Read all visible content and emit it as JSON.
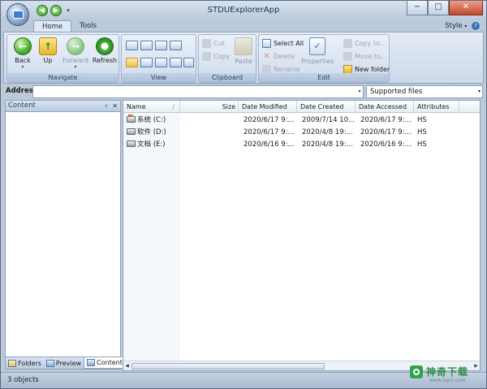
{
  "window": {
    "title": "STDUExplorerApp"
  },
  "caption": {
    "minimize": "−",
    "maximize": "□",
    "close": "✕"
  },
  "quick_access": {
    "arrows": [
      "◀",
      "▶"
    ],
    "drop": "▾"
  },
  "ribbon": {
    "tabs": [
      "Home",
      "Tools"
    ],
    "active_tab": "Home",
    "style_menu": "Style",
    "help": "?",
    "groups": {
      "navigate": {
        "label": "Navigate",
        "back": "Back",
        "up": "Up",
        "forward": "Forward",
        "refresh": "Refresh"
      },
      "view": {
        "label": "View"
      },
      "clipboard": {
        "label": "Clipboard",
        "cut": "Cut",
        "copy": "Copy",
        "paste": "Paste"
      },
      "edit": {
        "label": "Edit",
        "select_all": "Select All",
        "delete": "Delete",
        "rename": "Rename",
        "properties": "Properties",
        "copy_to": "Copy to...",
        "move_to": "Move to...",
        "new_folder": "New folder"
      }
    }
  },
  "address_bar": {
    "label": "Address",
    "value": "",
    "filter": "Supported files"
  },
  "left_pane": {
    "title": "Content",
    "controls": [
      "ᛜ",
      "✕"
    ],
    "tabs": [
      "Folders",
      "Preview",
      "Content"
    ],
    "active_tab": "Content"
  },
  "file_list": {
    "columns": [
      "Name",
      "Size",
      "Date Modified",
      "Date Created",
      "Date Accessed",
      "Attributes"
    ],
    "rows": [
      {
        "name": "系统 (C:)",
        "size": "",
        "modified": "2020/6/17 9:...",
        "created": "2009/7/14 10...",
        "accessed": "2020/6/17 9:...",
        "attributes": "HS"
      },
      {
        "name": "软件 (D:)",
        "size": "",
        "modified": "2020/6/17 9:...",
        "created": "2020/4/8 19:...",
        "accessed": "2020/6/17 9:...",
        "attributes": "HS"
      },
      {
        "name": "文档 (E:)",
        "size": "",
        "modified": "2020/6/16 9:...",
        "created": "2020/4/8 19:...",
        "accessed": "2020/6/16 9:...",
        "attributes": "HS"
      }
    ]
  },
  "status_bar": {
    "text": "3 objects"
  },
  "watermark": {
    "text": "神奇下载",
    "sub": "www.sqxz.com"
  }
}
